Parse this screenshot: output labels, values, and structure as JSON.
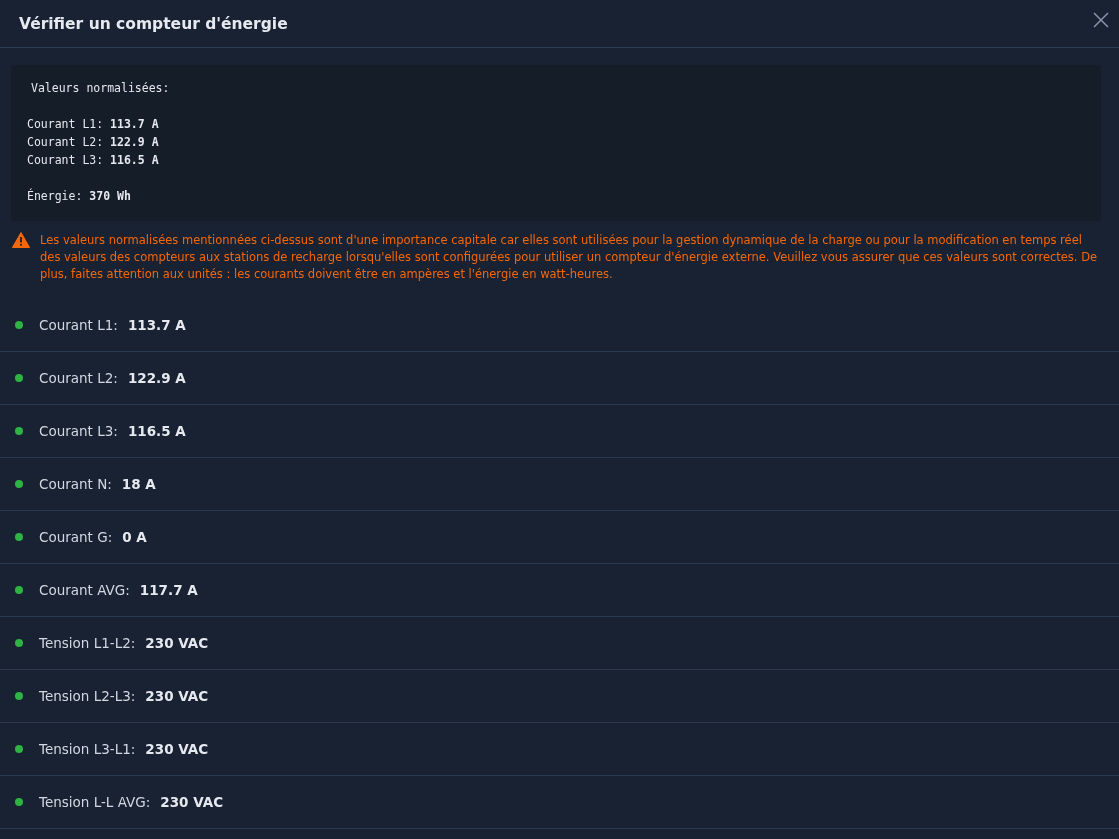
{
  "dialog": {
    "title": "Vérifier un compteur d'énergie"
  },
  "normalized": {
    "heading": "Valeurs normalisées:",
    "groups": [
      [
        {
          "label": "Courant L1:",
          "value": "113.7 A"
        },
        {
          "label": "Courant L2:",
          "value": "122.9 A"
        },
        {
          "label": "Courant L3:",
          "value": "116.5 A"
        }
      ],
      [
        {
          "label": "Énergie:",
          "value": "370 Wh"
        }
      ]
    ]
  },
  "warning": "Les valeurs normalisées mentionnées ci-dessus sont d'une importance capitale car elles sont utilisées pour la gestion dynamique de la charge ou pour la modification en temps réel des valeurs des compteurs aux stations de recharge lorsqu'elles sont configurées pour utiliser un compteur d'énergie externe. Veuillez vous assurer que ces valeurs sont correctes. De plus, faites attention aux unités : les courants doivent être en ampères et l'énergie en watt-heures.",
  "readings": [
    {
      "label": "Courant L1:",
      "value": "113.7 A",
      "color": "#2fb344"
    },
    {
      "label": "Courant L2:",
      "value": "122.9 A",
      "color": "#2fb344"
    },
    {
      "label": "Courant L3:",
      "value": "116.5 A",
      "color": "#2fb344"
    },
    {
      "label": "Courant N:",
      "value": "18 A",
      "color": "#2fb344"
    },
    {
      "label": "Courant G:",
      "value": "0 A",
      "color": "#2fb344"
    },
    {
      "label": "Courant AVG:",
      "value": "117.7 A",
      "color": "#2fb344"
    },
    {
      "label": "Tension L1-L2:",
      "value": "230 VAC",
      "color": "#2fb344"
    },
    {
      "label": "Tension L2-L3:",
      "value": "230 VAC",
      "color": "#2fb344"
    },
    {
      "label": "Tension L3-L1:",
      "value": "230 VAC",
      "color": "#2fb344"
    },
    {
      "label": "Tension L-L AVG:",
      "value": "230 VAC",
      "color": "#2fb344"
    }
  ]
}
